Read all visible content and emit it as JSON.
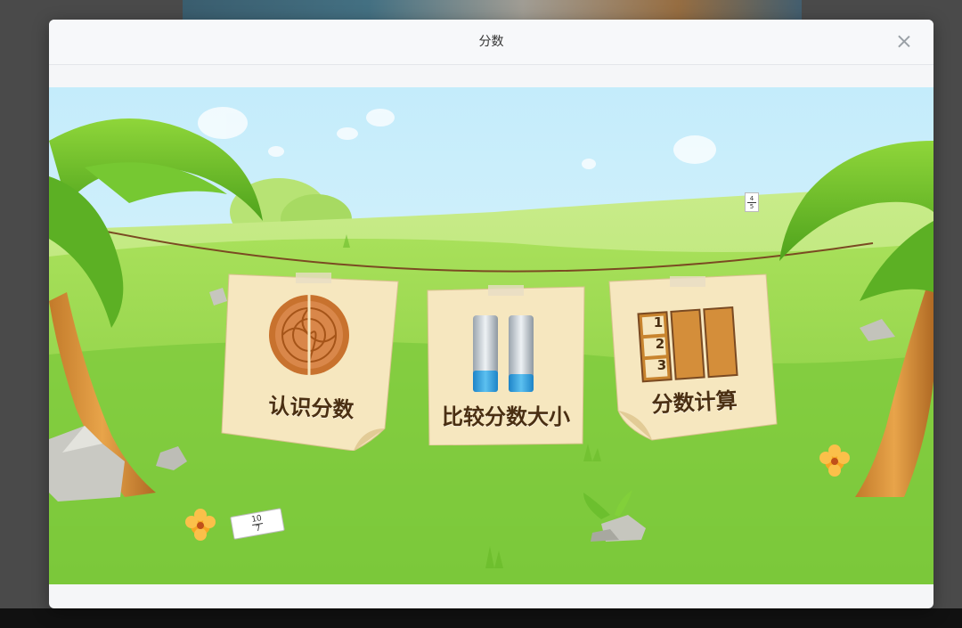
{
  "modal": {
    "title": "分数",
    "close_icon": "close-icon"
  },
  "menu": {
    "cards": [
      {
        "label": "认识分数",
        "icon": "mooncake-icon"
      },
      {
        "label": "比较分数大小",
        "icon": "measuring-cylinders-icon"
      },
      {
        "label": "分数计算",
        "icon": "number-tiles-icon"
      }
    ],
    "tile_numbers": [
      "1",
      "2",
      "3"
    ]
  },
  "scene": {
    "fraction_small": {
      "numerator": "4",
      "denominator": "5"
    },
    "fraction_sign": {
      "numerator": "10",
      "denominator": "7"
    }
  },
  "colors": {
    "sky": "#cdeefa",
    "grass": "#8fd44a",
    "paper": "#f6e7bf",
    "label": "#4a2f12"
  }
}
